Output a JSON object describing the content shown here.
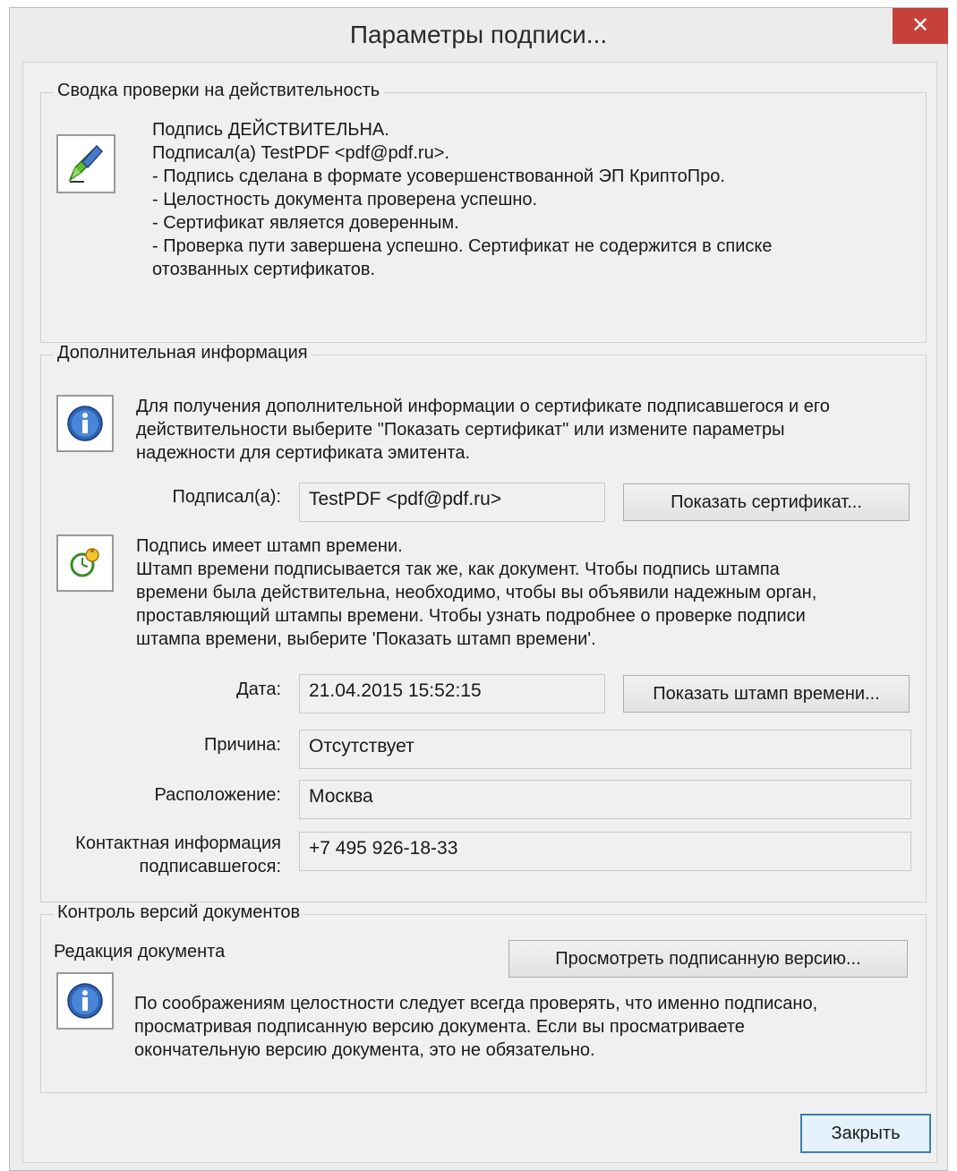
{
  "window": {
    "title": "Параметры подписи...",
    "close_glyph": "✕"
  },
  "summary": {
    "legend": "Сводка проверки на действительность",
    "lines": [
      "Подпись ДЕЙСТВИТЕЛЬНА.",
      "Подписал(а) TestPDF <pdf@pdf.ru>.",
      "- Подпись сделана в формате усовершенствованной ЭП КриптоПро.",
      "- Целостность документа проверена успешно.",
      "- Сертификат является доверенным.",
      "- Проверка пути завершена успешно. Сертификат не содержится в списке",
      "отозванных сертификатов."
    ]
  },
  "additional": {
    "legend": "Дополнительная информация",
    "info_lines": [
      "Для получения дополнительной информации о сертификате подписавшегося и его",
      "действительности выберите \"Показать сертификат\" или измените параметры",
      "надежности для сертификата эмитента."
    ],
    "signer_label": "Подписал(а):",
    "signer_value": "TestPDF <pdf@pdf.ru>",
    "show_cert_button": "Показать сертификат...",
    "timestamp_lines": [
      "Подпись имеет штамп времени.",
      "Штамп времени подписывается так же, как документ. Чтобы подпись штампа",
      "времени была действительна, необходимо, чтобы вы объявили надежным орган,",
      "проставляющий штампы времени. Чтобы узнать подробнее о проверке подписи",
      "штампа времени, выберите 'Показать штамп времени'."
    ],
    "date_label": "Дата:",
    "date_value": "21.04.2015 15:52:15",
    "show_timestamp_button": "Показать штамп времени...",
    "reason_label": "Причина:",
    "reason_value": "Отсутствует",
    "location_label": "Расположение:",
    "location_value": "Москва",
    "contact_label_line1": "Контактная информация",
    "contact_label_line2": "подписавшегося:",
    "contact_value": "+7 495 926-18-33"
  },
  "versions": {
    "legend": "Контроль версий документов",
    "revision_label": "Редакция документа",
    "view_signed_button": "Просмотреть подписанную версию...",
    "info_lines": [
      "По соображениям целостности следует всегда проверять, что именно подписано,",
      "просматривая подписанную версию документа. Если вы просматриваете",
      "окончательную версию документа, это не обязательно."
    ]
  },
  "footer": {
    "close_button": "Закрыть"
  },
  "icons": {
    "pen": "signature-valid-icon",
    "info": "info-icon",
    "timestamp": "timestamp-icon"
  },
  "colors": {
    "close_red": "#c7403a",
    "info_blue": "#2f64b5",
    "pen_green": "#5bbf2e"
  }
}
